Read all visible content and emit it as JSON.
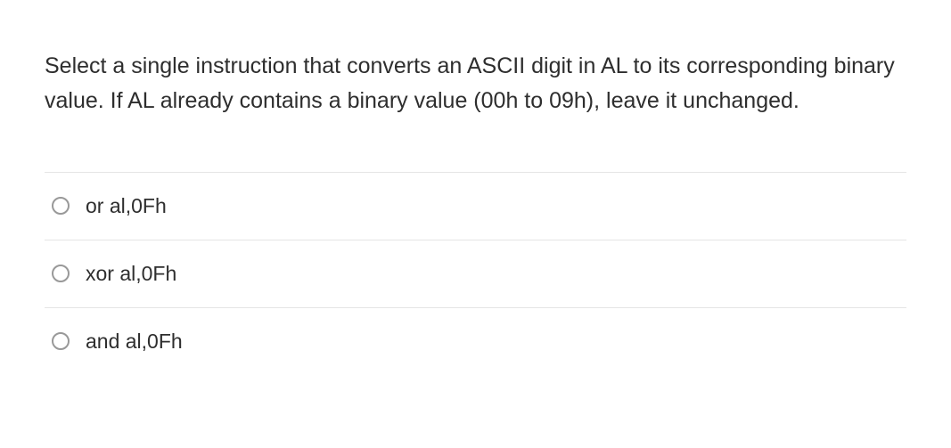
{
  "question": {
    "text": "Select a single instruction that converts an ASCII digit in AL to its corresponding binary value.  If AL already contains a binary value (00h to 09h), leave it unchanged."
  },
  "options": [
    {
      "label": "or al,0Fh"
    },
    {
      "label": "xor al,0Fh"
    },
    {
      "label": "and al,0Fh"
    }
  ]
}
